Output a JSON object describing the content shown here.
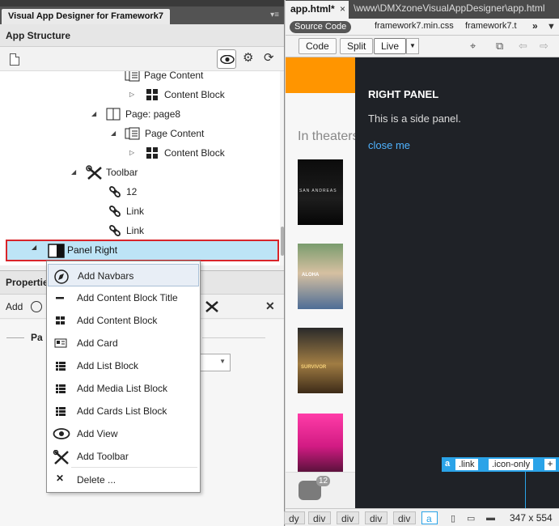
{
  "left_panel": {
    "panel_tab": "Visual App Designer for Framework7",
    "structure_header": "App Structure",
    "tree": [
      {
        "label": "Page Content"
      },
      {
        "label": "Content Block"
      },
      {
        "label": "Page: page8"
      },
      {
        "label": "Page Content"
      },
      {
        "label": "Content Block"
      },
      {
        "label": "Toolbar"
      },
      {
        "label": "12"
      },
      {
        "label": "Link"
      },
      {
        "label": "Link"
      }
    ],
    "selected_item": "Panel Right",
    "properties_header": "Properties",
    "add_label": "Add",
    "props_section": "Pa"
  },
  "context_menu": {
    "items": [
      {
        "label": "Add Navbars",
        "icon": "compass-icon"
      },
      {
        "label": "Add Content Block Title",
        "icon": "dash-icon"
      },
      {
        "label": "Add Content Block",
        "icon": "grid-icon"
      },
      {
        "label": "Add Card",
        "icon": "card-icon"
      },
      {
        "label": "Add List Block",
        "icon": "list-icon"
      },
      {
        "label": "Add Media List Block",
        "icon": "list-icon"
      },
      {
        "label": "Add Cards List Block",
        "icon": "list-icon"
      },
      {
        "label": "Add View",
        "icon": "eye-icon"
      },
      {
        "label": "Add Toolbar",
        "icon": "tools-icon"
      },
      {
        "label": "Delete ...",
        "icon": "x-icon"
      }
    ]
  },
  "document": {
    "tab_label": "app.html*",
    "tab_close": "×",
    "path": "\\www\\DMXzoneVisualAppDesigner\\app.html",
    "source_code": "Source Code",
    "related_files": [
      "framework7.min.css",
      "framework7.t"
    ],
    "view_buttons": {
      "code": "Code",
      "split": "Split",
      "live": "Live"
    }
  },
  "live_view": {
    "in_theaters": "In theaters",
    "movies": [
      "SAN ANDREAS",
      "ALOHA",
      "SURVIVOR",
      ""
    ],
    "panel_title": "RIGHT PANEL",
    "panel_text": "This is a side panel.",
    "panel_link": "close me",
    "badge_count": "12",
    "hud": {
      "tag": "a",
      "class1": ".link",
      "class2": ".icon-only",
      "plus": "+"
    }
  },
  "tag_selector": {
    "crumbs": [
      "dy",
      "div",
      "div",
      "div",
      "div",
      "a"
    ],
    "size": "347 x 554"
  }
}
